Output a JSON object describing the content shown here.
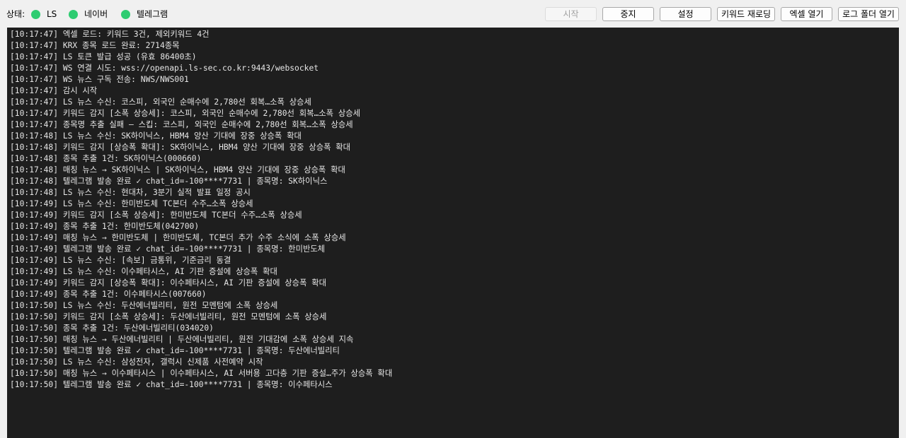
{
  "status": {
    "label": "상태:",
    "indicators": [
      {
        "label": "LS",
        "color": "#2ecc71"
      },
      {
        "label": "네이버",
        "color": "#2ecc71"
      },
      {
        "label": "텔레그램",
        "color": "#2ecc71"
      }
    ]
  },
  "toolbar": {
    "start_label": "시작",
    "stop_label": "중지",
    "settings_label": "설정",
    "reload_keywords_label": "키워드 재로딩",
    "open_excel_label": "엑셀 열기",
    "open_log_folder_label": "로그 폴더 열기"
  },
  "log": {
    "lines": [
      "[10:17:47] 엑셀 로드: 키워드 3건, 제외키워드 4건",
      "[10:17:47] KRX 종목 로드 완료: 2714종목",
      "[10:17:47] LS 토큰 발급 성공 (유효 86400초)",
      "[10:17:47] WS 연결 시도: wss://openapi.ls-sec.co.kr:9443/websocket",
      "[10:17:47] WS 뉴스 구독 전송: NWS/NWS001",
      "[10:17:47] 감시 시작",
      "[10:17:47] LS 뉴스 수신: 코스피, 외국인 순매수에 2,780선 회복…소폭 상승세",
      "[10:17:47] 키워드 감지 [소폭 상승세]: 코스피, 외국인 순매수에 2,780선 회복…소폭 상승세",
      "[10:17:47] 종목명 추출 실패 — 스킵: 코스피, 외국인 순매수에 2,780선 회복…소폭 상승세",
      "[10:17:48] LS 뉴스 수신: SK하이닉스, HBM4 양산 기대에 장중 상승폭 확대",
      "[10:17:48] 키워드 감지 [상승폭 확대]: SK하이닉스, HBM4 양산 기대에 장중 상승폭 확대",
      "[10:17:48] 종목 추출 1건: SK하이닉스(000660)",
      "[10:17:48] 매칭 뉴스 → SK하이닉스 | SK하이닉스, HBM4 양산 기대에 장중 상승폭 확대",
      "[10:17:48] 텔레그램 발송 완료 ✓ chat_id=-100****7731 | 종목명: SK하이닉스",
      "[10:17:48] LS 뉴스 수신: 현대차, 3분기 실적 발표 일정 공시",
      "[10:17:49] LS 뉴스 수신: 한미반도체 TC본더 수주…소폭 상승세",
      "[10:17:49] 키워드 감지 [소폭 상승세]: 한미반도체 TC본더 수주…소폭 상승세",
      "[10:17:49] 종목 추출 1건: 한미반도체(042700)",
      "[10:17:49] 매칭 뉴스 → 한미반도체 | 한미반도체, TC본더 추가 수주 소식에 소폭 상승세",
      "[10:17:49] 텔레그램 발송 완료 ✓ chat_id=-100****7731 | 종목명: 한미반도체",
      "[10:17:49] LS 뉴스 수신: [속보] 금통위, 기준금리 동결",
      "[10:17:49] LS 뉴스 수신: 이수페타시스, AI 기판 증설에 상승폭 확대",
      "[10:17:49] 키워드 감지 [상승폭 확대]: 이수페타시스, AI 기판 증설에 상승폭 확대",
      "[10:17:49] 종목 추출 1건: 이수페타시스(007660)",
      "[10:17:50] LS 뉴스 수신: 두산에너빌리티, 원전 모멘텀에 소폭 상승세",
      "[10:17:50] 키워드 감지 [소폭 상승세]: 두산에너빌리티, 원전 모멘텀에 소폭 상승세",
      "[10:17:50] 종목 추출 1건: 두산에너빌리티(034020)",
      "[10:17:50] 매칭 뉴스 → 두산에너빌리티 | 두산에너빌리티, 원전 기대감에 소폭 상승세 지속",
      "[10:17:50] 텔레그램 발송 완료 ✓ chat_id=-100****7731 | 종목명: 두산에너빌리티",
      "[10:17:50] LS 뉴스 수신: 삼성전자, 갤럭시 신제품 사전예약 시작",
      "[10:17:50] 매칭 뉴스 → 이수페타시스 | 이수페타시스, AI 서버용 고다층 기판 증설…주가 상승폭 확대",
      "[10:17:50] 텔레그램 발송 완료 ✓ chat_id=-100****7731 | 종목명: 이수페타시스"
    ]
  }
}
